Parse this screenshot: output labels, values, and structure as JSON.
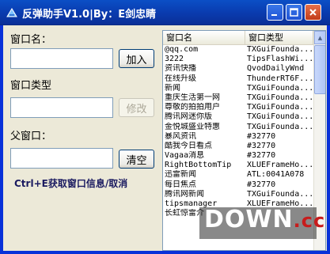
{
  "window": {
    "title": "反弹助手V1.0|By：E剑忠睛"
  },
  "form": {
    "window_name_label": "窗口名：",
    "window_name_value": "",
    "add_button": "加入",
    "window_class_label": "窗口类型",
    "window_class_value": "",
    "modify_button": "修改",
    "parent_window_label": "父窗口：",
    "parent_window_value": "",
    "clear_button": "清空",
    "hint": "Ctrl+E获取窗口信息/取消"
  },
  "list": {
    "columns": [
      "窗口名",
      "窗口类型"
    ],
    "rows": [
      [
        "@qq.com",
        "TXGuiFounda..."
      ],
      [
        "3222",
        "TipsFlashWi..."
      ],
      [
        "资讯快播",
        "QvodDailyWnd"
      ],
      [
        "在线升级",
        "ThunderRT6F..."
      ],
      [
        "新闻",
        "TXGuiFounda..."
      ],
      [
        "重庆生活第一网",
        "TXGuiFounda..."
      ],
      [
        "尊敬的拍拍用户",
        "TXGuiFounda..."
      ],
      [
        "腾讯网迷你版",
        "TXGuiFounda..."
      ],
      [
        "金悦城盛业特惠",
        "TXGuiFounda..."
      ],
      [
        "暴风资讯",
        "#32770"
      ],
      [
        "酷我今日看点",
        "#32770"
      ],
      [
        "Vagaa消息",
        "#32770"
      ],
      [
        "RightBottomTip",
        "XLUEFrameHo..."
      ],
      [
        "迅雷新闻",
        "ATL:0041A078"
      ],
      [
        "每日焦点",
        "#32770"
      ],
      [
        "腾讯网新闻",
        "TXGuiFounda..."
      ],
      [
        "tipsmanager",
        "XLUEFrameHo..."
      ],
      [
        "长虹惊雷介",
        ""
      ]
    ]
  },
  "watermark": {
    "text_main": "DOWN",
    "text_suffix": ".cc"
  },
  "colors": {
    "titlebar": "#0a3cb0",
    "face": "#ece9d8",
    "watermark_suffix": "#c71c1c"
  }
}
